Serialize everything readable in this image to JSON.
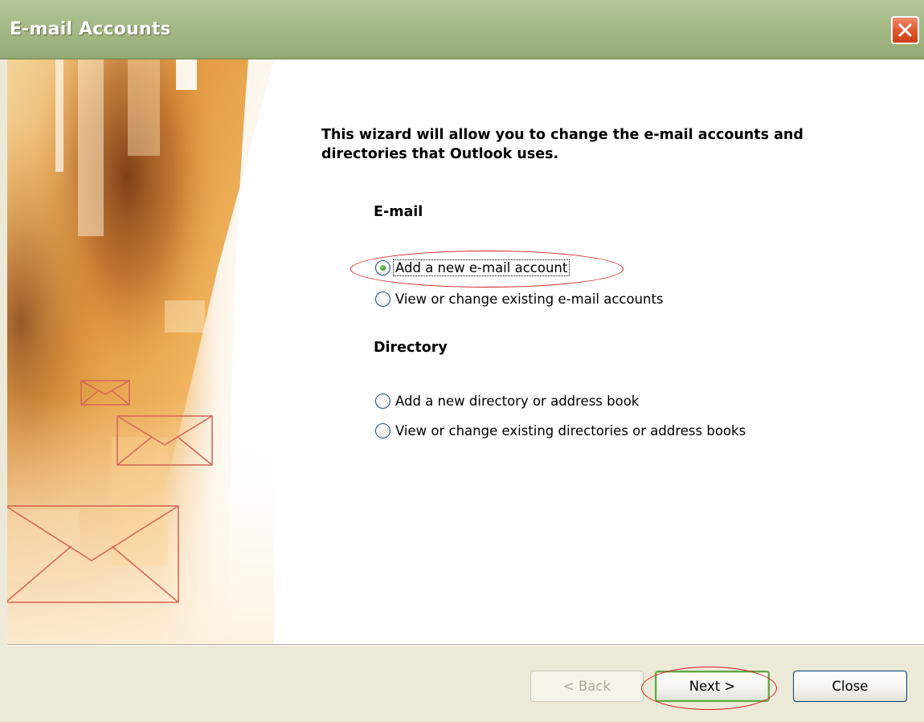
{
  "window": {
    "title": "E-mail Accounts"
  },
  "intro": {
    "text": "This wizard will allow you to change the e-mail accounts and directories that Outlook uses."
  },
  "sections": {
    "email": {
      "heading": "E-mail",
      "options": [
        {
          "label": "Add a new e-mail account",
          "checked": true
        },
        {
          "label": "View or change existing e-mail accounts",
          "checked": false
        }
      ]
    },
    "directory": {
      "heading": "Directory",
      "options": [
        {
          "label": "Add a new directory or address book",
          "checked": false
        },
        {
          "label": "View or change existing directories or address books",
          "checked": false
        }
      ]
    }
  },
  "buttons": {
    "back": {
      "label": "< Back",
      "enabled": false
    },
    "next": {
      "label": "Next >",
      "default": true
    },
    "close": {
      "label": "Close"
    }
  },
  "colors": {
    "titlebar": "#9fb37f",
    "annotation": "#d81c1c",
    "art_orange": "#e59a3c",
    "art_brown": "#8a4a1e"
  }
}
